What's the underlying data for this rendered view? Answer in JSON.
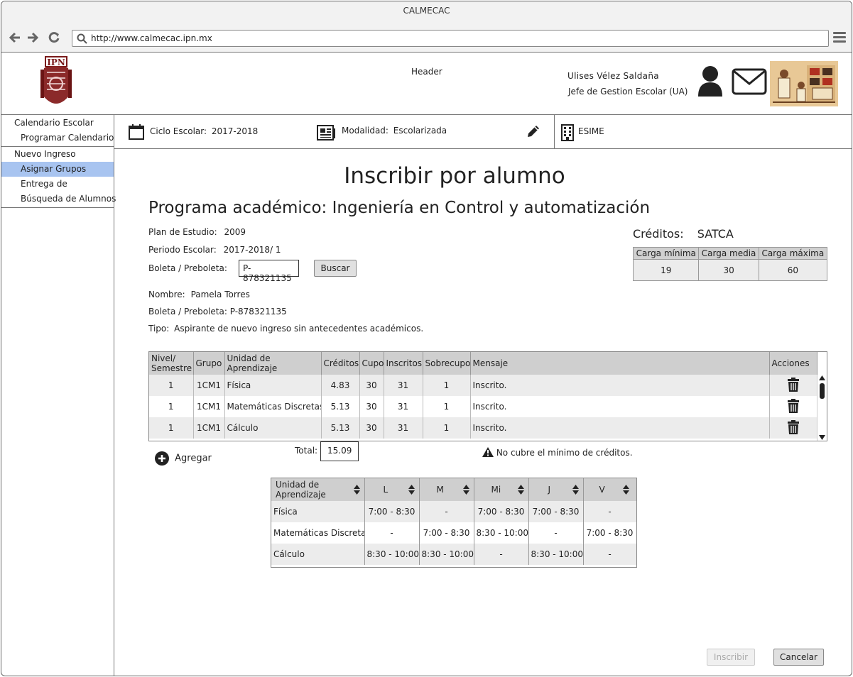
{
  "window": {
    "title": "CALMECAC"
  },
  "browser": {
    "url": "http://www.calmecac.ipn.mx"
  },
  "header": {
    "label": "Header",
    "user_name": "Ulises Vélez Saldaña",
    "user_role": "Jefe de Gestion Escolar (UA)"
  },
  "sidebar": {
    "items": [
      {
        "label": "Calendario Escolar"
      },
      {
        "label": "Programar Calendario"
      },
      {
        "label": "Nuevo Ingreso"
      },
      {
        "label": "Asignar Grupos"
      },
      {
        "label": "Entrega de"
      },
      {
        "label": "Búsqueda de Alumnos"
      }
    ]
  },
  "infobar": {
    "ciclo_label": "Ciclo Escolar:",
    "ciclo_value": "2017-2018",
    "modalidad_label": "Modalidad:",
    "modalidad_value": "Escolarizada",
    "escuela": "ESIME"
  },
  "page": {
    "title": "Inscribir por alumno",
    "program": "Programa académico: Ingeniería en Control y automatización",
    "plan_label": "Plan de Estudio:",
    "plan_value": "2009",
    "periodo_label": "Periodo Escolar:",
    "periodo_value": "2017-2018/ 1",
    "boleta_label": "Boleta / Preboleta:",
    "boleta_input": "P-878321135",
    "buscar_label": "Buscar",
    "nombre_label": "Nombre:",
    "nombre_value": "Pamela Torres",
    "boleta2_label": "Boleta / Preboleta:",
    "boleta2_value": "P-878321135",
    "tipo_label": "Tipo:",
    "tipo_value": "Aspirante de nuevo ingreso sin antecedentes académicos."
  },
  "creditos": {
    "title": "Créditos:",
    "system": "SATCA",
    "headers": [
      "Carga mínima",
      "Carga media",
      "Carga máxima"
    ],
    "values": [
      "19",
      "30",
      "60"
    ]
  },
  "grid": {
    "headers": [
      "Nivel/ Semestre",
      "Grupo",
      "Unidad de Aprendizaje",
      "Créditos",
      "Cupo",
      "Inscritos",
      "Sobrecupo",
      "Mensaje",
      "Acciones"
    ],
    "rows": [
      {
        "nivel": "1",
        "grupo": "1CM1",
        "unidad": "Física",
        "creditos": "4.83",
        "cupo": "30",
        "inscritos": "31",
        "sobrecupo": "1",
        "mensaje": "Inscrito."
      },
      {
        "nivel": "1",
        "grupo": "1CM1",
        "unidad": "Matemáticas Discretas",
        "creditos": "5.13",
        "cupo": "30",
        "inscritos": "31",
        "sobrecupo": "1",
        "mensaje": "Inscrito."
      },
      {
        "nivel": "1",
        "grupo": "1CM1",
        "unidad": "Cálculo",
        "creditos": "5.13",
        "cupo": "30",
        "inscritos": "31",
        "sobrecupo": "1",
        "mensaje": "Inscrito."
      }
    ]
  },
  "agregar_label": "Agregar",
  "total": {
    "label": "Total:",
    "value": "15.09"
  },
  "warning": "No cubre el mínimo de créditos.",
  "schedule": {
    "headers": [
      "Unidad de Aprendizaje",
      "L",
      "M",
      "Mi",
      "J",
      "V"
    ],
    "rows": [
      {
        "unidad": "Física",
        "L": "7:00 - 8:30",
        "M": "-",
        "Mi": "7:00 - 8:30",
        "J": "7:00 - 8:30",
        "V": "-"
      },
      {
        "unidad": "Matemáticas Discretas",
        "L": "-",
        "M": "7:00 - 8:30",
        "Mi": "8:30 - 10:00",
        "J": "-",
        "V": "7:00 - 8:30"
      },
      {
        "unidad": "Cálculo",
        "L": "8:30 - 10:00",
        "M": "8:30 - 10:00",
        "Mi": "-",
        "J": "8:30 - 10:00",
        "V": "-"
      }
    ]
  },
  "actions": {
    "inscribir": "Inscribir",
    "cancelar": "Cancelar"
  },
  "colors": {
    "selected_sidebar": "#a8c4f0",
    "table_header": "#cfcfcf",
    "logo": "#7a1a1a"
  }
}
